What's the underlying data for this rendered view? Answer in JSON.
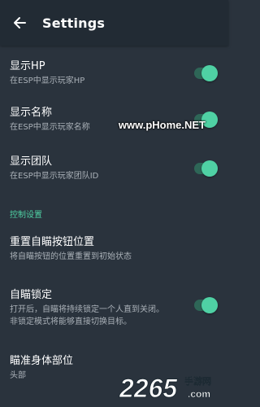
{
  "appbar": {
    "title": "Settings",
    "back_icon": "arrow-left-icon"
  },
  "settings": [
    {
      "title": "显示HP",
      "subtitle": "在ESP中显示玩家HP",
      "toggle_on": true
    },
    {
      "title": "显示名称",
      "subtitle": "在ESP中显示玩家名称",
      "toggle_on": true
    },
    {
      "title": "显示团队",
      "subtitle": "在ESP中显示玩家团队ID",
      "toggle_on": true
    }
  ],
  "section": {
    "label": "控制设置"
  },
  "controls": [
    {
      "title": "重置自瞄按钮位置",
      "subtitle": "将自瞄按钮的位置重置到初始状态"
    },
    {
      "title": "自瞄锁定",
      "subtitle_line1": "打开后，自瞄将持续锁定一个人直到关闭。",
      "subtitle_line2": "非锁定模式将能够直接切换目标。",
      "toggle_on": true
    },
    {
      "title": "瞄准身体部位",
      "subtitle": "头部"
    }
  ],
  "watermark": {
    "text": "www.pHome.NET"
  },
  "logo": {
    "number": "2265",
    "domain": ".com",
    "tagline": "手游网"
  },
  "colors": {
    "accent": "#4fd1a4",
    "background": "#2a333d",
    "appbar": "#222b34"
  }
}
